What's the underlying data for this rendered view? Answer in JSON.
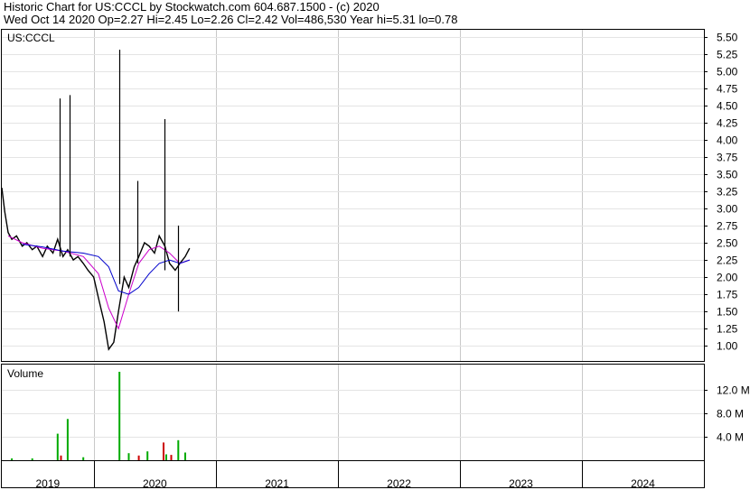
{
  "header": {
    "line1": "Historic Chart for US:CCCL by Stockwatch.com 604.687.1500 - (c) 2020",
    "line2": "Wed Oct 14 2020  Op=2.27  Hi=2.45  Lo=2.26  Cl=2.42  Vol=486,530  Year hi=5.31  lo=0.78"
  },
  "chart_data": [
    {
      "type": "line",
      "title": "US:CCCL",
      "ylim": [
        0.78,
        5.6
      ],
      "yticks": [
        "5.50",
        "5.25",
        "5.00",
        "4.75",
        "4.50",
        "4.25",
        "4.00",
        "3.75",
        "3.50",
        "3.25",
        "3.00",
        "2.75",
        "2.50",
        "2.25",
        "2.00",
        "1.75",
        "1.50",
        "1.25",
        "1.00"
      ],
      "x_years": [
        "2019",
        "2020",
        "2021",
        "2022",
        "2023",
        "2024"
      ],
      "x_year_starts": [
        "2019-01-01",
        "2020-01-01",
        "2021-01-01",
        "2022-01-01",
        "2023-01-01",
        "2024-01-01",
        "2025-01-01"
      ],
      "x_range": [
        "2019-04-01",
        "2024-12-31"
      ],
      "grid": true,
      "legend": "none",
      "colors": {
        "price": "#000000",
        "ma_short": "#cc00cc",
        "ma_long": "#0000cc"
      },
      "series": [
        {
          "values_kind": "price",
          "x": [
            "2019-04-01",
            "2019-04-10",
            "2019-04-20",
            "2019-05-01",
            "2019-05-15",
            "2019-06-01",
            "2019-06-15",
            "2019-07-01",
            "2019-07-15",
            "2019-08-01",
            "2019-08-15",
            "2019-09-01",
            "2019-09-15",
            "2019-10-01",
            "2019-10-15",
            "2019-11-01",
            "2019-11-15",
            "2019-12-01",
            "2019-12-15",
            "2020-01-01",
            "2020-01-15",
            "2020-02-01",
            "2020-02-15",
            "2020-03-01",
            "2020-03-15",
            "2020-04-01",
            "2020-04-15",
            "2020-05-01",
            "2020-05-15",
            "2020-06-01",
            "2020-06-15",
            "2020-07-01",
            "2020-07-15",
            "2020-08-01",
            "2020-08-15",
            "2020-09-01",
            "2020-09-15",
            "2020-10-01",
            "2020-10-14"
          ],
          "values": [
            3.3,
            2.95,
            2.65,
            2.55,
            2.6,
            2.45,
            2.5,
            2.4,
            2.45,
            2.3,
            2.45,
            2.35,
            2.55,
            2.3,
            2.4,
            2.25,
            2.3,
            2.2,
            2.1,
            2.0,
            1.7,
            1.35,
            0.95,
            1.05,
            1.5,
            2.0,
            1.85,
            2.15,
            2.3,
            2.5,
            2.45,
            2.35,
            2.6,
            2.45,
            2.2,
            2.1,
            2.2,
            2.3,
            2.42
          ]
        },
        {
          "values_kind": "moving_average_short",
          "x": [
            "2019-04-20",
            "2019-06-01",
            "2019-08-01",
            "2019-10-01",
            "2019-12-01",
            "2020-01-15",
            "2020-02-15",
            "2020-03-15",
            "2020-04-15",
            "2020-05-15",
            "2020-06-15",
            "2020-07-15",
            "2020-08-15",
            "2020-09-15",
            "2020-10-14"
          ],
          "values": [
            2.6,
            2.5,
            2.42,
            2.38,
            2.3,
            2.05,
            1.55,
            1.25,
            1.75,
            2.2,
            2.4,
            2.45,
            2.35,
            2.2,
            2.25
          ]
        },
        {
          "values_kind": "moving_average_long",
          "x": [
            "2019-06-01",
            "2019-08-01",
            "2019-10-01",
            "2019-12-01",
            "2020-01-15",
            "2020-02-15",
            "2020-03-15",
            "2020-04-15",
            "2020-05-15",
            "2020-06-15",
            "2020-07-15",
            "2020-08-15",
            "2020-09-15",
            "2020-10-14"
          ],
          "values": [
            2.48,
            2.44,
            2.38,
            2.35,
            2.3,
            2.15,
            1.8,
            1.75,
            1.85,
            2.05,
            2.2,
            2.25,
            2.2,
            2.25
          ]
        }
      ],
      "spikes": [
        {
          "x": "2019-09-20",
          "high": 4.6,
          "low": 2.3
        },
        {
          "x": "2019-10-20",
          "high": 4.65,
          "low": 2.3
        },
        {
          "x": "2020-03-18",
          "high": 5.31,
          "low": 1.9
        },
        {
          "x": "2020-05-10",
          "high": 3.4,
          "low": 2.2
        },
        {
          "x": "2020-08-01",
          "high": 4.3,
          "low": 2.1
        },
        {
          "x": "2020-09-10",
          "high": 2.75,
          "low": 1.5
        }
      ]
    },
    {
      "type": "bar",
      "title": "Volume",
      "ylim": [
        0,
        15
      ],
      "yticks": [
        "12.0 M",
        "8.0 M",
        "4.0 M"
      ],
      "ytick_values": [
        12,
        8,
        4
      ],
      "unit": "M",
      "bars": [
        {
          "x": "2019-05-01",
          "value": 0.3,
          "color": "#00aa00"
        },
        {
          "x": "2019-07-01",
          "value": 0.3,
          "color": "#00aa00"
        },
        {
          "x": "2019-09-15",
          "value": 4.5,
          "color": "#00aa00"
        },
        {
          "x": "2019-09-25",
          "value": 0.8,
          "color": "#cc0000"
        },
        {
          "x": "2019-10-15",
          "value": 7.0,
          "color": "#00aa00"
        },
        {
          "x": "2019-12-01",
          "value": 0.5,
          "color": "#00aa00"
        },
        {
          "x": "2020-03-18",
          "value": 15.0,
          "color": "#00aa00"
        },
        {
          "x": "2020-04-15",
          "value": 1.2,
          "color": "#00aa00"
        },
        {
          "x": "2020-05-15",
          "value": 0.8,
          "color": "#cc0000"
        },
        {
          "x": "2020-06-10",
          "value": 1.5,
          "color": "#00aa00"
        },
        {
          "x": "2020-07-28",
          "value": 3.0,
          "color": "#cc0000"
        },
        {
          "x": "2020-08-05",
          "value": 1.0,
          "color": "#00aa00"
        },
        {
          "x": "2020-08-20",
          "value": 0.9,
          "color": "#cc0000"
        },
        {
          "x": "2020-09-10",
          "value": 3.4,
          "color": "#00aa00"
        },
        {
          "x": "2020-10-01",
          "value": 1.3,
          "color": "#00aa00"
        }
      ]
    }
  ]
}
